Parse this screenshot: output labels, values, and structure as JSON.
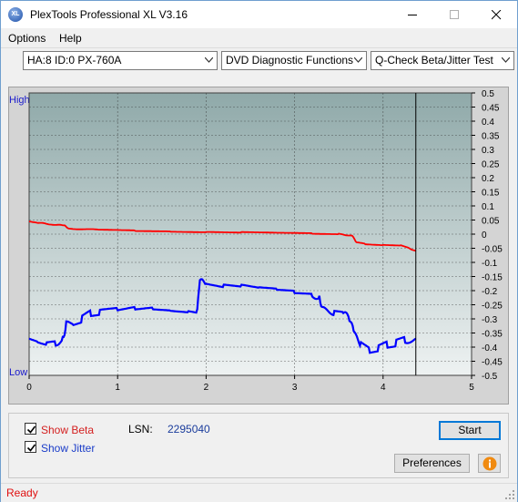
{
  "window": {
    "title": "PlexTools Professional XL V3.16",
    "app_icon_text": "XL",
    "minimize_icon": "minimize-icon",
    "maximize_icon": "maximize-icon",
    "close_icon": "close-icon"
  },
  "menu": {
    "options_label": "Options",
    "help_label": "Help"
  },
  "toolbar": {
    "drive_select": "HA:8 ID:0  PX-760A",
    "function_select": "DVD Diagnostic Functions",
    "test_select": "Q-Check Beta/Jitter Test"
  },
  "chart": {
    "left_top_label": "High",
    "left_bottom_label": "Low",
    "colors": {
      "beta": "#ff0000",
      "jitter": "#0000ff",
      "plot_top": "#8fa9a9",
      "plot_bottom": "#eef2f2",
      "grid": "#303030"
    }
  },
  "chart_data": {
    "type": "line",
    "xlim": [
      0,
      5
    ],
    "ylim": [
      -0.5,
      0.5
    ],
    "x_ticks": [
      "0",
      "1",
      "2",
      "3",
      "4",
      "5"
    ],
    "y_ticks": [
      "0.5",
      "0.45",
      "0.4",
      "0.35",
      "0.3",
      "0.25",
      "0.2",
      "0.15",
      "0.1",
      "0.05",
      "0",
      "-0.05",
      "-0.1",
      "-0.15",
      "-0.2",
      "-0.25",
      "-0.3",
      "-0.35",
      "-0.4",
      "-0.45",
      "-0.5"
    ],
    "y_tick_values": [
      0.5,
      0.45,
      0.4,
      0.35,
      0.3,
      0.25,
      0.2,
      0.15,
      0.1,
      0.05,
      0,
      -0.05,
      -0.1,
      -0.15,
      -0.2,
      -0.25,
      -0.3,
      -0.35,
      -0.4,
      -0.45,
      -0.5
    ],
    "grid": true,
    "marker_x": 4.37,
    "series": [
      {
        "color": "#ff0000",
        "x": [
          0,
          0.1,
          0.25,
          0.4,
          0.45,
          0.8,
          1.2,
          1.6,
          2.0,
          2.4,
          2.8,
          3.2,
          3.5,
          3.65,
          3.7,
          3.8,
          4.0,
          4.2,
          4.3,
          4.37
        ],
        "y": [
          0.045,
          0.04,
          0.035,
          0.03,
          0.02,
          0.015,
          0.012,
          0.01,
          0.008,
          0.006,
          0.004,
          0.002,
          0.0,
          -0.005,
          -0.03,
          -0.035,
          -0.038,
          -0.04,
          -0.05,
          -0.06
        ]
      },
      {
        "color": "#0000ff",
        "x": [
          0,
          0.1,
          0.2,
          0.3,
          0.38,
          0.42,
          0.5,
          0.6,
          0.7,
          0.8,
          1.0,
          1.2,
          1.4,
          1.6,
          1.8,
          1.9,
          1.93,
          2.0,
          2.2,
          2.4,
          2.6,
          2.8,
          3.0,
          3.2,
          3.28,
          3.32,
          3.45,
          3.55,
          3.62,
          3.68,
          3.75,
          3.85,
          3.95,
          4.05,
          4.15,
          4.25,
          4.37
        ],
        "y": [
          -0.37,
          -0.38,
          -0.39,
          -0.385,
          -0.37,
          -0.32,
          -0.31,
          -0.3,
          -0.28,
          -0.275,
          -0.27,
          -0.26,
          -0.255,
          -0.26,
          -0.265,
          -0.27,
          -0.17,
          -0.175,
          -0.185,
          -0.19,
          -0.2,
          -0.205,
          -0.21,
          -0.215,
          -0.22,
          -0.27,
          -0.275,
          -0.28,
          -0.3,
          -0.36,
          -0.39,
          -0.41,
          -0.405,
          -0.39,
          -0.385,
          -0.375,
          -0.37
        ]
      }
    ]
  },
  "controls": {
    "show_beta_label": "Show Beta",
    "show_jitter_label": "Show Jitter",
    "show_beta_checked": true,
    "show_jitter_checked": true,
    "beta_color": "#d42020",
    "jitter_color": "#1a3cc8",
    "lsn_label": "LSN:",
    "lsn_value": "2295040",
    "start_label": "Start",
    "preferences_label": "Preferences",
    "info_icon": "info-icon"
  },
  "status": {
    "text": "Ready"
  }
}
